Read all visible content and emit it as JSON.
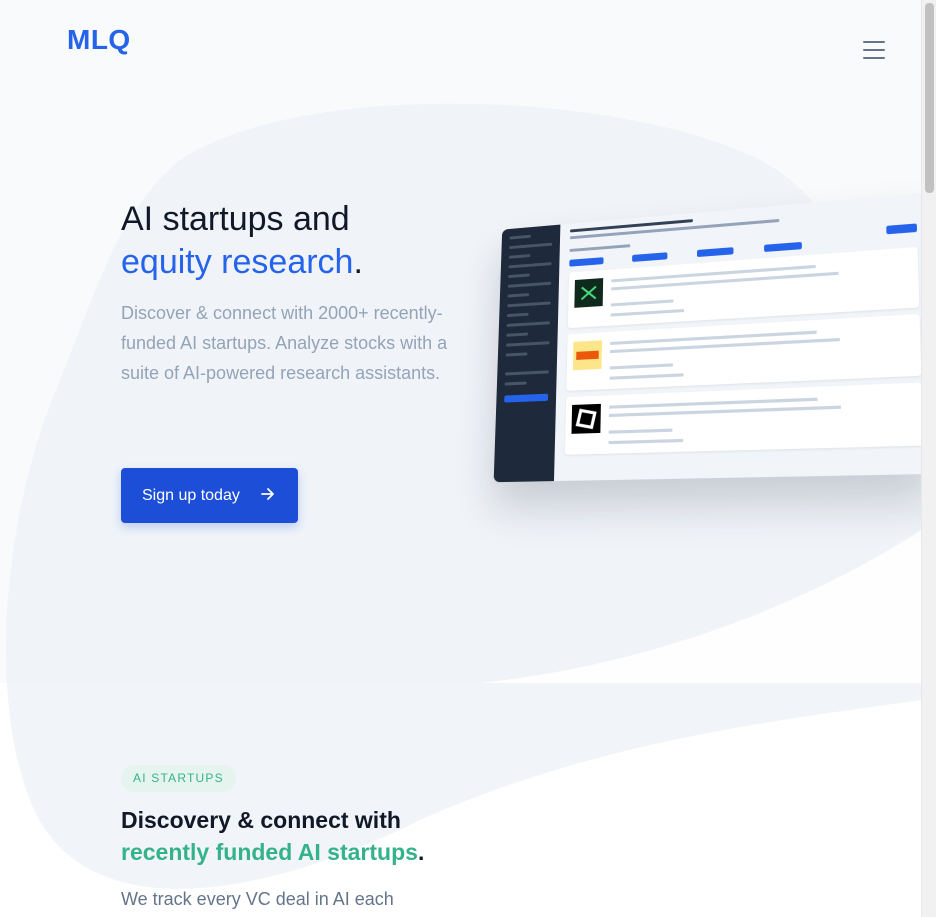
{
  "header": {
    "logo": "MLQ",
    "menu_icon": "hamburger-menu-icon"
  },
  "hero": {
    "title_line1": "AI startups and",
    "title_accent": "equity research",
    "title_period": ".",
    "description": "Discover & connect with 2000+ recently-funded AI startups. Analyze stocks with a suite of AI-powered research assistants.",
    "cta_label": "Sign up today",
    "cta_icon": "arrow-right-icon"
  },
  "section_startups": {
    "badge": "AI STARTUPS",
    "title_line1": "Discovery & connect with",
    "title_accent": "recently funded AI startups",
    "title_period": ".",
    "description": "We track every VC deal in AI each"
  },
  "colors": {
    "primary_blue": "#2563eb",
    "button_blue": "#1d4ed8",
    "accent_green": "#34b38a",
    "muted_text": "#94a3b8"
  }
}
